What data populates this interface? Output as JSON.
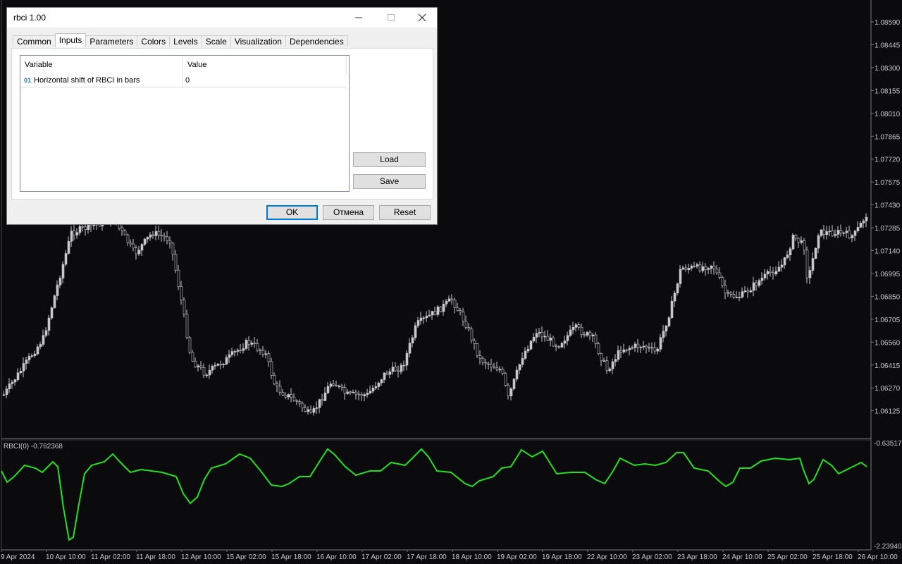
{
  "dialog": {
    "title": "rbci 1.00",
    "tabs": [
      {
        "label": "Common"
      },
      {
        "label": "Inputs"
      },
      {
        "label": "Parameters"
      },
      {
        "label": "Colors"
      },
      {
        "label": "Levels"
      },
      {
        "label": "Scale"
      },
      {
        "label": "Visualization"
      },
      {
        "label": "Dependencies"
      }
    ],
    "active_tab": "Inputs",
    "grid": {
      "col_variable": "Variable",
      "col_value": "Value",
      "rows": [
        {
          "type_icon": "01",
          "variable": "Horizontal shift of RBCI in bars",
          "value": "0"
        }
      ]
    },
    "load_label": "Load",
    "save_label": "Save",
    "ok_label": "OK",
    "cancel_label": "Отмена",
    "reset_label": "Reset"
  },
  "chart": {
    "price_labels": [
      "1.08590",
      "1.08445",
      "1.08300",
      "1.08155",
      "1.08010",
      "1.07865",
      "1.07720",
      "1.07575",
      "1.07430",
      "1.07285",
      "1.07140",
      "1.06995",
      "1.06850",
      "1.06705",
      "1.06560",
      "1.06415",
      "1.06270",
      "1.06125"
    ],
    "date_labels": [
      "9 Apr 2024",
      "10 Apr 10:00",
      "11 Apr 02:00",
      "11 Apr 18:00",
      "12 Apr 10:00",
      "15 Apr 02:00",
      "15 Apr 18:00",
      "16 Apr 10:00",
      "17 Apr 02:00",
      "17 Apr 18:00",
      "18 Apr 10:00",
      "19 Apr 02:00",
      "19 Apr 18:00",
      "22 Apr 10:00",
      "23 Apr 02:00",
      "23 Apr 18:00",
      "24 Apr 10:00",
      "25 Apr 02:00",
      "25 Apr 18:00",
      "26 Apr 10:00"
    ],
    "indicator_label": "RBCI(0) -0.762368",
    "indicator_max_label": "-0.635171",
    "indicator_min_label": "-2.239406",
    "candle_color": "#c8c8c8",
    "indicator_color": "#22e01e"
  }
}
